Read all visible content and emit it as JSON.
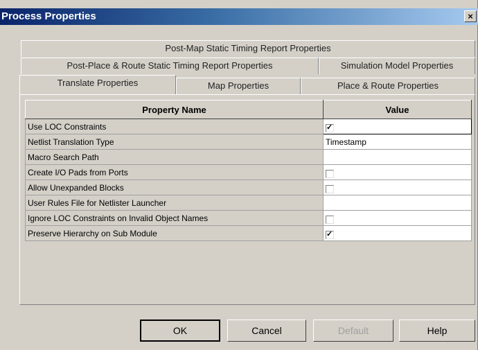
{
  "window": {
    "title": "Process Properties",
    "close_glyph": "×"
  },
  "tabs": {
    "row1": [
      {
        "label": "Post-Map Static Timing Report Properties"
      }
    ],
    "row2": [
      {
        "label": "Post-Place & Route Static Timing Report Properties"
      },
      {
        "label": "Simulation Model Properties"
      }
    ],
    "row3": [
      {
        "label": "Translate Properties",
        "active": true
      },
      {
        "label": "Map Properties"
      },
      {
        "label": "Place & Route Properties"
      }
    ]
  },
  "grid": {
    "headers": {
      "name": "Property Name",
      "value": "Value"
    },
    "rows": [
      {
        "name": "Use LOC Constraints",
        "type": "checkbox",
        "checked": true,
        "selected": true
      },
      {
        "name": "Netlist Translation Type",
        "type": "text",
        "value": "Timestamp"
      },
      {
        "name": "Macro Search Path",
        "type": "text",
        "value": ""
      },
      {
        "name": "Create I/O Pads from Ports",
        "type": "checkbox",
        "checked": false
      },
      {
        "name": "Allow Unexpanded Blocks",
        "type": "checkbox",
        "checked": false
      },
      {
        "name": "User Rules File for Netlister Launcher",
        "type": "text",
        "value": ""
      },
      {
        "name": "Ignore LOC Constraints on Invalid Object Names",
        "type": "checkbox",
        "checked": false
      },
      {
        "name": "Preserve Hierarchy on Sub Module",
        "type": "checkbox",
        "checked": true
      }
    ]
  },
  "buttons": {
    "ok": "OK",
    "cancel": "Cancel",
    "default": "Default",
    "help": "Help"
  },
  "colors": {
    "face": "#d4d0c8",
    "titlebar_start": "#0a246a",
    "titlebar_end": "#a6caf0",
    "disabled_text": "#a0a0a0"
  }
}
